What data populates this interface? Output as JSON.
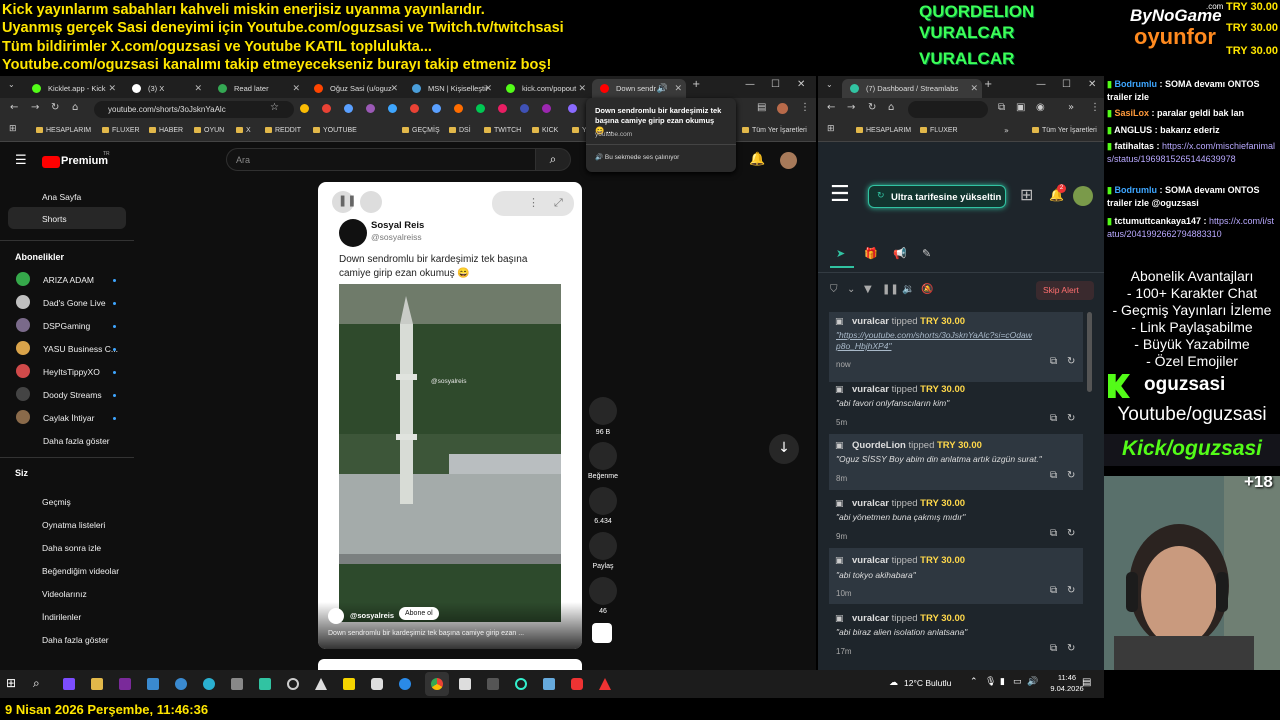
{
  "banner": {
    "lines": [
      "Kick yayınlarım sabahları kahveli miskin enerjisiz uyanma yayınlarıdır.",
      "Uyanmış gerçek Sasi deneyimi için Youtube.com/oguzsasi ve Twitch.tv/twitchsasi",
      "Tüm bildirimler X.com/oguzsasi ve Youtube KATIL toplulukta...",
      "Youtube.com/oguzsasi kanalımı takip etmeyecekseniz burayı takip etmeniz boş!"
    ],
    "tippers": [
      "QUORDELION",
      "VURALCAR",
      "VURALCAR"
    ],
    "tip_values": [
      "TRY 30.00",
      "TRY 30.00",
      "TRY 30.00"
    ],
    "logo_top": "ByNoGame",
    "logo_bottom": "oyunfor",
    "logo_suffix": ".com"
  },
  "left_browser": {
    "tabs": [
      {
        "label": "Kicklet.app - Kick",
        "color": "#53fc18"
      },
      {
        "label": "(3) X",
        "color": "#ffffff"
      },
      {
        "label": "Read later",
        "color": "#34a853"
      },
      {
        "label": "Oğuz Sasi (u/oguz",
        "color": "#ff4500"
      },
      {
        "label": "MSN | Kişiselleştir",
        "color": "#4a9eda"
      },
      {
        "label": "kick.com/popout",
        "color": "#53fc18"
      },
      {
        "label": "Down sendr",
        "color": "#ff0000"
      }
    ],
    "url": "youtube.com/shorts/3oJsknYaAlc",
    "bookmarks": [
      "HESAPLARIM",
      "FLUXER",
      "HABER",
      "OYUN",
      "X",
      "REDDIT",
      "YOUTUBE",
      "GEÇMİŞ",
      "DSİ",
      "TWITCH",
      "KICK",
      "Yİ"
    ],
    "all_bookmarks": "Tüm Yer İşaretleri",
    "tooltip": {
      "title": "Down sendromlu bir kardeşimiz tek başına camiye girip ezan okumuş 😄 ...",
      "domain": "youtube.com",
      "sound": "Bu sekmede ses çalınıyor"
    }
  },
  "youtube": {
    "brand": "Premium",
    "brand_sup": "TR",
    "search_placeholder": "Ara",
    "sidebar": {
      "home": "Ana Sayfa",
      "shorts": "Shorts",
      "subs_header": "Abonelikler",
      "subs": [
        {
          "name": "ARIZA ADAM",
          "color": "#35a84a"
        },
        {
          "name": "Dad's Gone Live",
          "color": "#c0c0c0"
        },
        {
          "name": "DSPGaming",
          "color": "#7a6a8a"
        },
        {
          "name": "YASU Business C...",
          "color": "#d9a34a"
        },
        {
          "name": "HeyItsTippyXO",
          "color": "#d04a4a"
        },
        {
          "name": "Doody Streams",
          "color": "#444444"
        },
        {
          "name": "Caylak İhtiyar",
          "color": "#8a6a4a"
        }
      ],
      "more": "Daha fazla göster",
      "you_header": "Siz",
      "you_items": [
        "Geçmiş",
        "Oynatma listeleri",
        "Daha sonra izle",
        "Beğendiğim videolar",
        "Videolarınız",
        "İndirilenler",
        "Daha fazla göster"
      ]
    },
    "short": {
      "channel": "Sosyal Reis",
      "handle": "@sosyalreiss",
      "text": "Down sendromlu bir kardeşimiz tek başına camiye girip ezan okumuş 😄",
      "watermark": "@sosyalreis",
      "bottom_channel": "@sosyalreis",
      "subscribe": "Abone ol",
      "caption": "Down sendromlu bir kardeşimiz tek başına camiye girip ezan ..."
    },
    "actions": [
      "96 B",
      "Beğenme",
      "6.434",
      "Paylaş",
      "46"
    ]
  },
  "right_browser": {
    "tab": "(7) Dashboard / Streamlabs",
    "bookmarks": [
      "HESAPLARIM",
      "FLUXER"
    ],
    "all_bookmarks": "Tüm Yer İşaretleri",
    "upgrade": "Ultra tarifesine yükseltin",
    "notif_count": "2",
    "skip": "Skip Alert",
    "alerts": [
      {
        "user": "vuralcar",
        "verb": "tipped",
        "amount": "TRY 30.00",
        "msg": "\"https://youtube.com/shorts/3oJsknYaAlc?si=cOdawp8o_HbjhXP4\"",
        "time": "now"
      },
      {
        "user": "vuralcar",
        "verb": "tipped",
        "amount": "TRY 30.00",
        "msg": "\"abi favori onlyfanscıların kim\"",
        "time": "5m"
      },
      {
        "user": "QuordeLion",
        "verb": "tipped",
        "amount": "TRY 30.00",
        "msg": "\"Oguz SİSSY Boy abim din anlatma artık üzgün surat.\"",
        "time": "8m"
      },
      {
        "user": "vuralcar",
        "verb": "tipped",
        "amount": "TRY 30.00",
        "msg": "\"abi yönetmen buna çakmış mıdır\"",
        "time": "9m"
      },
      {
        "user": "vuralcar",
        "verb": "tipped",
        "amount": "TRY 30.00",
        "msg": "\"abi tokyo akihabara\"",
        "time": "10m"
      },
      {
        "user": "vuralcar",
        "verb": "tipped",
        "amount": "TRY 30.00",
        "msg": "\"abi biraz alien isolation anlatsana\"",
        "time": "17m"
      }
    ]
  },
  "chat": [
    {
      "user": "Bodrumlu",
      "ucolor": "#3ea6ff",
      "text": "SOMA devamı ONTOS trailer izle"
    },
    {
      "user": "SasiLox",
      "ucolor": "#ff9a3c",
      "text": "paralar geldi bak lan"
    },
    {
      "user": "ANGLUS",
      "ucolor": "#ffffff",
      "text": "bakarız ederiz"
    },
    {
      "user": "fatihaltas",
      "ucolor": "#ffffff",
      "text": "",
      "link": "https://x.com/mischiefanimals/status/1969815265144639978"
    },
    {
      "user": "Bodrumlu",
      "ucolor": "#3ea6ff",
      "text": "SOMA devamı ONTOS trailer izle @oguzsasi"
    },
    {
      "user": "tctumuttcankaya147",
      "ucolor": "#ffffff",
      "text": "",
      "link": "https://x.com/i/status/2041992662794883310"
    }
  ],
  "perks": {
    "title": "Abonelik Avantajları",
    "items": [
      "- 100+ Karakter Chat",
      "- Geçmiş Yayınları İzleme",
      "- Link Paylaşabilme",
      "- Büyük Yazabilme",
      "- Özel Emojiler"
    ],
    "kick_name": "oguzsasi",
    "youtube": "Youtube/oguzsasi",
    "kick_url": "Kick/oguzsasi",
    "age": "+18"
  },
  "taskbar": {
    "weather": "12°C  Bulutlu",
    "time": "11:46",
    "date": "9.04.2026"
  },
  "bottom_clock": "9 Nisan 2026 Perşembe, 11:46:36"
}
